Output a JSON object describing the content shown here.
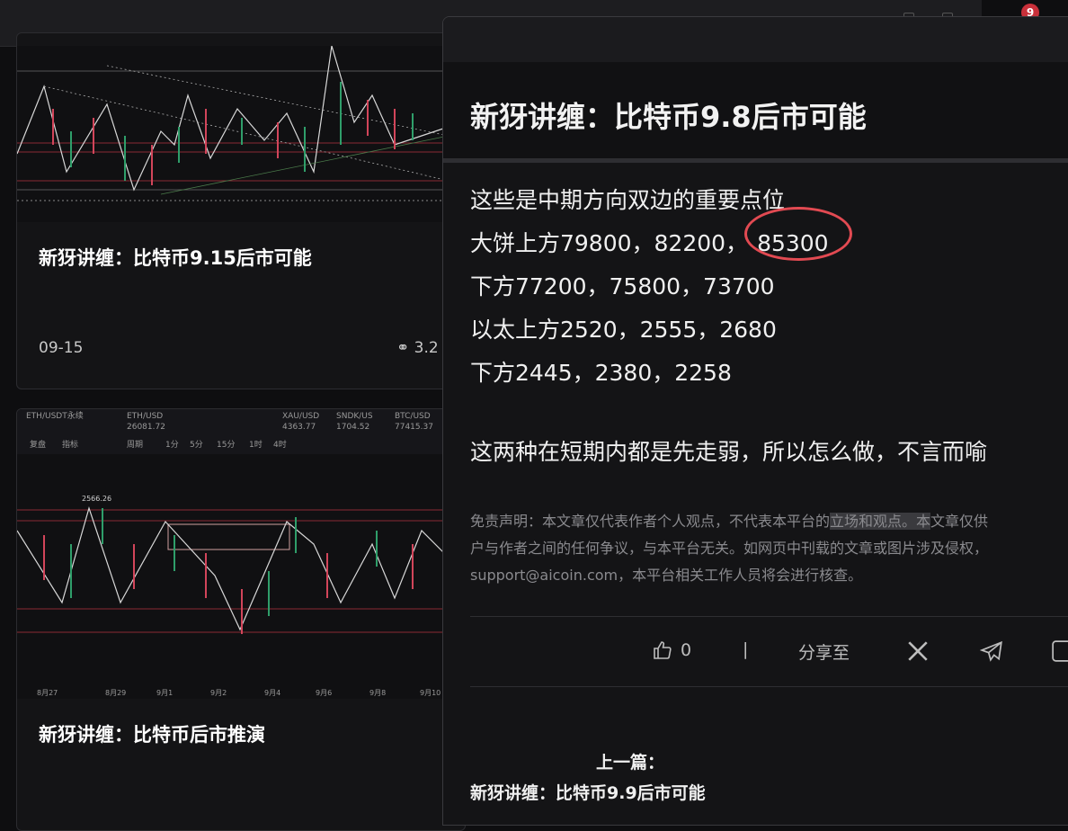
{
  "notifications": {
    "count": "9"
  },
  "cards": [
    {
      "title": "新犽讲缠：比特币9.15后市可能",
      "date": "09-15",
      "views": "3.2"
    },
    {
      "title": "新犽讲缠：比特币后市推演",
      "chart_tags": [
        "ETH/USDT永续",
        "ETH/USD",
        "XAU/USD",
        "SNDK/US",
        "BTC/USD"
      ],
      "chart_values": [
        "26081.72",
        "4363.77",
        "1704.52",
        "77415.37"
      ],
      "chart_toolbar": [
        "复盘",
        "指标",
        "周期",
        "1分",
        "5分",
        "15分",
        "1时",
        "4时"
      ],
      "chart_peak": "2566.26",
      "chart_dates": [
        "8月27",
        "8月29",
        "9月1",
        "9月2",
        "9月4",
        "9月6",
        "9月8",
        "9月10"
      ]
    }
  ],
  "article": {
    "title": "新犽讲缠：比特币9.8后市可能",
    "lines": [
      "这些是中期方向双边的重要点位",
      "大饼上方79800，82200，",
      "85300",
      "下方77200，75800，73700",
      "以太上方2520，2555，2680",
      "下方2445，2380，2258",
      "这两种在短期内都是先走弱，所以怎么做，不言而喻"
    ],
    "disclaimer": {
      "part1": "免责声明：本文章仅代表作者个人观点，不代表本平台的",
      "part2": "立场和观点。本",
      "part3": "文章仅供",
      "line2": "户与作者之间的任何争议，与本平台无关。如网页中刊载的文章或图片涉及侵权，",
      "line3": "support@aicoin.com，本平台相关工作人员将会进行核查。"
    },
    "likes": "0",
    "separator": "|",
    "share_label": "分享至",
    "prev_label": "上一篇：",
    "prev_title": "新犽讲缠：比特币9.9后市可能"
  },
  "colors": {
    "highlight": "#e24a52",
    "candle_up": "#2f9e6a",
    "candle_down": "#d2455a"
  }
}
